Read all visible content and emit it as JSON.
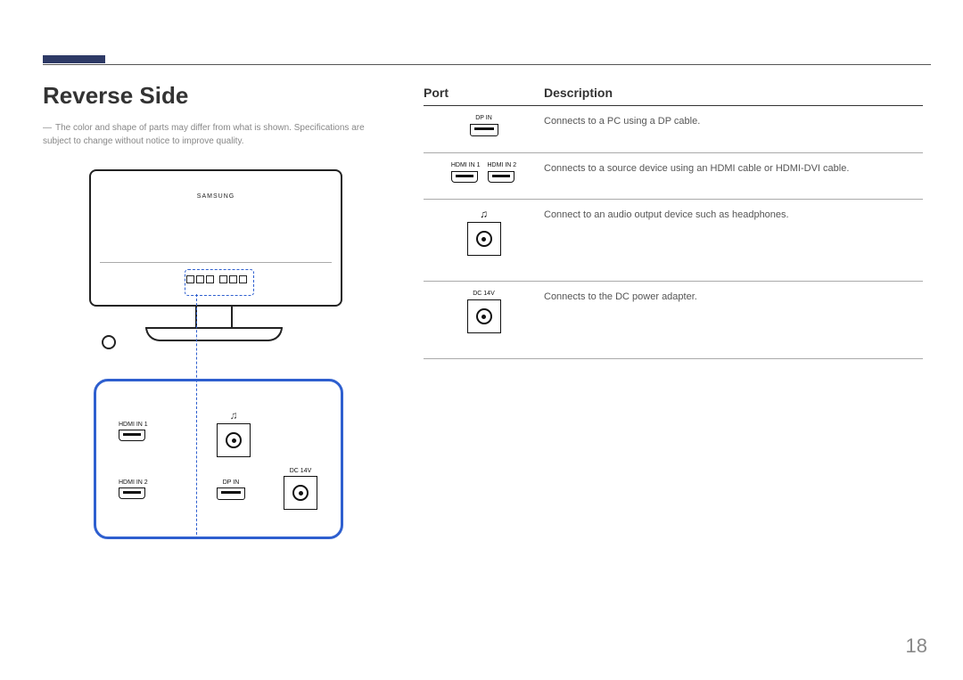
{
  "page_number": "18",
  "heading": "Reverse Side",
  "note": "The color and shape of parts may differ from what is shown. Specifications are subject to change without notice to improve quality.",
  "monitor_brand": "SAMSUNG",
  "detail_ports": {
    "hdmi1": "HDMI IN 1",
    "hdmi2": "HDMI IN 2",
    "dp": "DP IN",
    "dc": "DC 14V"
  },
  "table": {
    "head_port": "Port",
    "head_desc": "Description",
    "rows": [
      {
        "port_label": "DP IN",
        "desc": "Connects to a PC using a DP cable."
      },
      {
        "port_label_a": "HDMI IN 1",
        "port_label_b": "HDMI IN 2",
        "desc": "Connects to a source device using an HDMI cable or HDMI-DVI cable."
      },
      {
        "port_label": "",
        "desc": "Connect to an audio output device such as headphones."
      },
      {
        "port_label": "DC 14V",
        "desc": "Connects to the DC power adapter."
      }
    ]
  }
}
